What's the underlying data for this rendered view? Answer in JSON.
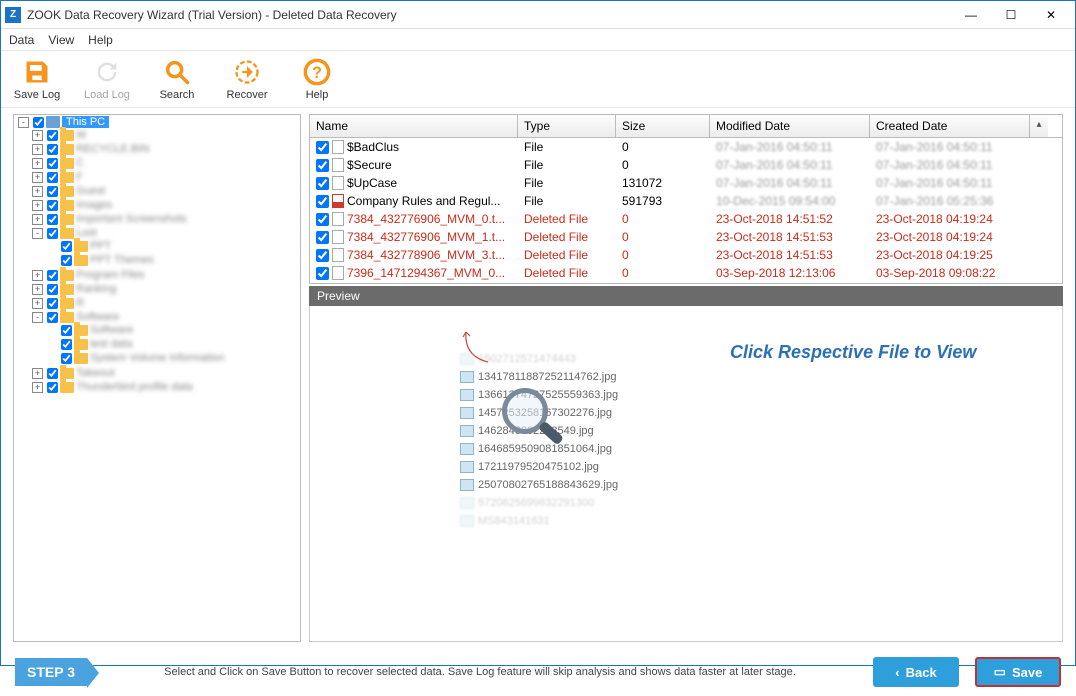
{
  "window": {
    "icon_letter": "Z",
    "title": "ZOOK Data Recovery Wizard (Trial Version) - Deleted Data Recovery"
  },
  "menu": {
    "items": [
      "Data",
      "View",
      "Help"
    ]
  },
  "toolbar": {
    "save_log": "Save Log",
    "load_log": "Load Log",
    "search": "Search",
    "recover": "Recover",
    "help": "Help"
  },
  "tree": {
    "root": "This PC",
    "children": [
      "W",
      "RECYCLE.BIN",
      "C",
      "F",
      "Guest",
      "Images",
      "Important Screenshots",
      "Lost",
      "Program Files",
      "Ranking",
      "R",
      "Software",
      "Takeout",
      "Thunderbird profile data"
    ],
    "lost_children": [
      "PPT",
      "PPT Themes"
    ],
    "software_children": [
      "Software",
      "test data",
      "System Volume Information"
    ]
  },
  "table": {
    "headers": {
      "name": "Name",
      "type": "Type",
      "size": "Size",
      "mod": "Modified Date",
      "cre": "Created Date"
    },
    "rows": [
      {
        "name": "$BadClus",
        "type": "File",
        "size": "0",
        "mod": "07-Jan-2016 04:50:11",
        "cre": "07-Jan-2016 04:50:11",
        "deleted": false,
        "icon": "file"
      },
      {
        "name": "$Secure",
        "type": "File",
        "size": "0",
        "mod": "07-Jan-2016 04:50:11",
        "cre": "07-Jan-2016 04:50:11",
        "deleted": false,
        "icon": "file"
      },
      {
        "name": "$UpCase",
        "type": "File",
        "size": "131072",
        "mod": "07-Jan-2016 04:50:11",
        "cre": "07-Jan-2016 04:50:11",
        "deleted": false,
        "icon": "file"
      },
      {
        "name": "Company Rules and Regul...",
        "type": "File",
        "size": "591793",
        "mod": "10-Dec-2015 09:54:00",
        "cre": "07-Jan-2016 05:25:36",
        "deleted": false,
        "icon": "pdf"
      },
      {
        "name": "7384_432776906_MVM_0.t...",
        "type": "Deleted File",
        "size": "0",
        "mod": "23-Oct-2018 14:51:52",
        "cre": "23-Oct-2018 04:19:24",
        "deleted": true,
        "icon": "file"
      },
      {
        "name": "7384_432776906_MVM_1.t...",
        "type": "Deleted File",
        "size": "0",
        "mod": "23-Oct-2018 14:51:53",
        "cre": "23-Oct-2018 04:19:24",
        "deleted": true,
        "icon": "file"
      },
      {
        "name": "7384_432778906_MVM_3.t...",
        "type": "Deleted File",
        "size": "0",
        "mod": "23-Oct-2018 14:51:53",
        "cre": "23-Oct-2018 04:19:25",
        "deleted": true,
        "icon": "file"
      },
      {
        "name": "7396_1471294367_MVM_0...",
        "type": "Deleted File",
        "size": "0",
        "mod": "03-Sep-2018 12:13:06",
        "cre": "03-Sep-2018 09:08:22",
        "deleted": true,
        "icon": "file"
      }
    ]
  },
  "preview": {
    "header": "Preview",
    "hint": "Click Respective File to View",
    "sample_files": [
      "1502712571474443",
      "13417811887252114762.jpg",
      "13661374727525559363.jpg",
      "1457253258167302276.jpg",
      "1462846802283549.jpg",
      "1646859509081851064.jpg",
      "17211979520475102.jpg",
      "25070802765188843629.jpg",
      "5720625699832291300",
      "MS843141631"
    ]
  },
  "bottom": {
    "step_label": "STEP 3",
    "description": "Select and Click on Save Button to recover selected data. Save Log feature will skip analysis and shows data faster at later stage.",
    "back": "Back",
    "save": "Save"
  }
}
